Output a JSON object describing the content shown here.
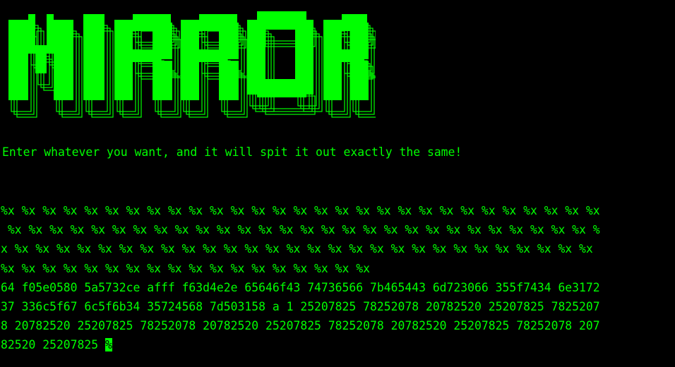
{
  "terminal": {
    "banner_text": "MIRROR",
    "intro_text": "Enter whatever you want, and it will spit it out exactly the same!",
    "output_lines": [
      "%x %x %x %x %x %x %x %x %x %x %x %x %x %x %x %x %x %x %x %x %x %x %x %x %x %x %x %x %x",
      " %x %x %x %x %x %x %x %x %x %x %x %x %x %x %x %x %x %x %x %x %x %x %x %x %x %x %x %x %",
      "x %x %x %x %x %x %x %x %x %x %x %x %x %x %x %x %x %x %x %x %x %x %x %x %x %x %x %x %x",
      "%x %x %x %x %x %x %x %x %x %x %x %x %x %x %x %x %x %x",
      "64 f05e0580 5a5732ce afff f63d4e2e 65646f43 74736566 7b465443 6d723066 355f7434 6e3172",
      "37 336c5f67 6c5f6b34 35724568 7d503158 a 1 25207825 78252078 20782520 25207825 7825207",
      "8 20782520 25207825 78252078 20782520 25207825 78252078 20782520 25207825 78252078 207",
      "82520 25207825 "
    ],
    "cursor_char": "%"
  },
  "colors": {
    "background": "#000000",
    "foreground": "#00ff00"
  }
}
